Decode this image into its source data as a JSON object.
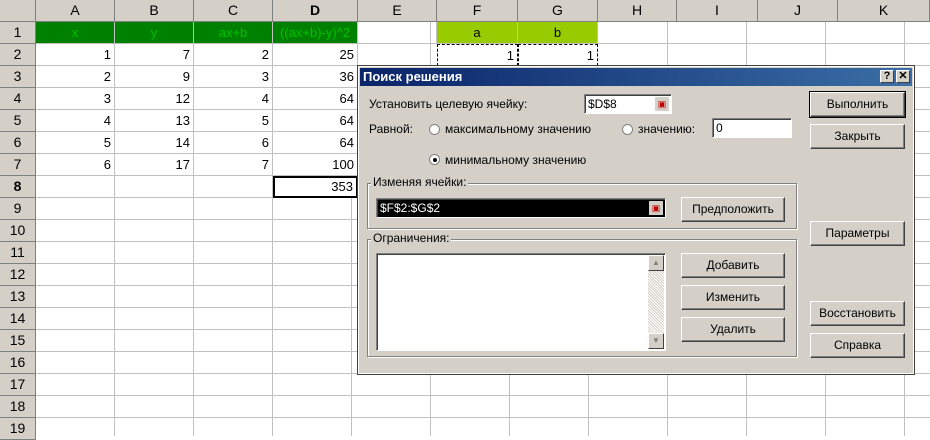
{
  "sheet": {
    "columns": [
      "A",
      "B",
      "C",
      "D",
      "E",
      "F",
      "G",
      "H",
      "I",
      "J",
      "K"
    ],
    "rows": [
      "1",
      "2",
      "3",
      "4",
      "5",
      "6",
      "7",
      "8",
      "9",
      "10",
      "11",
      "12",
      "13",
      "14",
      "15",
      "16",
      "17",
      "18",
      "19"
    ],
    "headers_row1": {
      "A": "x",
      "B": "y",
      "C": "ax+b",
      "D": "((ax+b)-y)^2",
      "F": "a",
      "G": "b"
    },
    "data": [
      {
        "A": "1",
        "B": "7",
        "C": "2",
        "D": "25"
      },
      {
        "A": "2",
        "B": "9",
        "C": "3",
        "D": "36"
      },
      {
        "A": "3",
        "B": "12",
        "C": "4",
        "D": "64"
      },
      {
        "A": "4",
        "B": "13",
        "C": "5",
        "D": "64"
      },
      {
        "A": "5",
        "B": "14",
        "C": "6",
        "D": "64"
      },
      {
        "A": "6",
        "B": "17",
        "C": "7",
        "D": "100"
      }
    ],
    "F2": "1",
    "G2": "1",
    "D8": "353"
  },
  "dialog": {
    "title": "Поиск решения",
    "help_glyph": "?",
    "close_glyph": "✕",
    "target_label": "Установить целевую ячейку:",
    "target_value": "$D$8",
    "equal_label": "Равной:",
    "opt_max": "максимальному значению",
    "opt_value": "значению:",
    "value_field": "0",
    "opt_min": "минимальному значению",
    "changing_label": "Изменяя ячейки:",
    "changing_value": "$F$2:$G$2",
    "guess_btn": "Предположить",
    "constraints_label": "Ограничения:",
    "add_btn": "Добавить",
    "change_btn": "Изменить",
    "delete_btn": "Удалить",
    "run_btn": "Выполнить",
    "close_btn": "Закрыть",
    "params_btn": "Параметры",
    "reset_btn": "Восстановить",
    "help_btn": "Справка"
  }
}
